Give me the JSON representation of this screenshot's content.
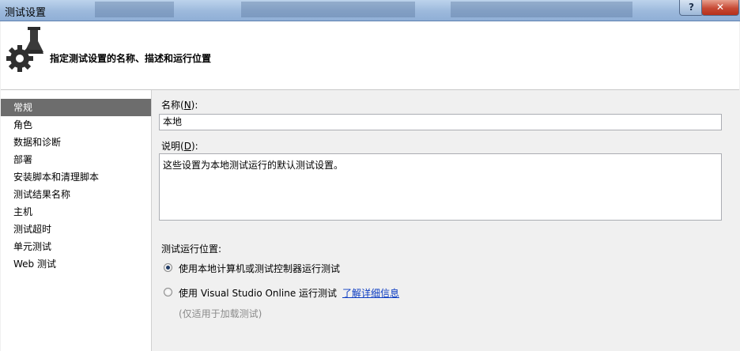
{
  "window": {
    "title": "测试设置",
    "help_label": "?",
    "close_label": "✕"
  },
  "header": {
    "icon": "flask-gear-icon",
    "description": "指定测试设置的名称、描述和运行位置"
  },
  "nav": {
    "items": [
      {
        "label": "常规",
        "selected": true
      },
      {
        "label": "角色"
      },
      {
        "label": "数据和诊断"
      },
      {
        "label": "部署"
      },
      {
        "label": "安装脚本和清理脚本"
      },
      {
        "label": "测试结果名称"
      },
      {
        "label": "主机"
      },
      {
        "label": "测试超时"
      },
      {
        "label": "单元测试"
      },
      {
        "label": "Web 测试"
      }
    ]
  },
  "form": {
    "name_label_pre": "名称(",
    "name_label_key": "N",
    "name_label_post": "):",
    "name_value": "本地",
    "desc_label_pre": "说明(",
    "desc_label_key": "D",
    "desc_label_post": "):",
    "desc_value": "这些设置为本地测试运行的默认测试设置。",
    "location_label": "测试运行位置:",
    "option_local": "使用本地计算机或测试控制器运行测试",
    "option_online": "使用 Visual Studio Online 运行测试",
    "learn_more": "了解详细信息",
    "load_test_note": "(仅适用于加载测试)",
    "selected_option": "local"
  }
}
